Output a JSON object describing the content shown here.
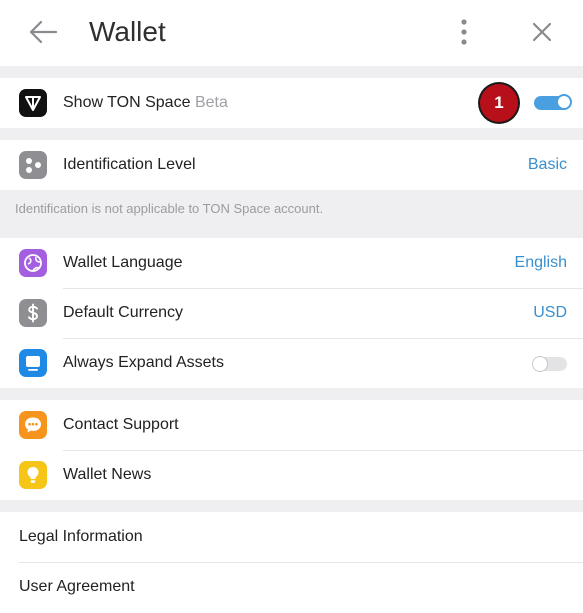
{
  "header": {
    "title": "Wallet"
  },
  "ton_space": {
    "label": "Show TON Space",
    "tag": "Beta",
    "badge": "1",
    "toggle_on": true
  },
  "identification": {
    "label": "Identification Level",
    "value": "Basic",
    "note": "Identification is not applicable to TON Space account."
  },
  "settings": {
    "language_label": "Wallet Language",
    "language_value": "English",
    "currency_label": "Default Currency",
    "currency_value": "USD",
    "expand_label": "Always Expand Assets",
    "expand_on": false
  },
  "support": {
    "contact_label": "Contact Support",
    "news_label": "Wallet News"
  },
  "legal": {
    "legal_label": "Legal Information",
    "agreement_label": "User Agreement"
  },
  "colors": {
    "accent": "#3a8fd0",
    "badge": "#b7101a"
  }
}
